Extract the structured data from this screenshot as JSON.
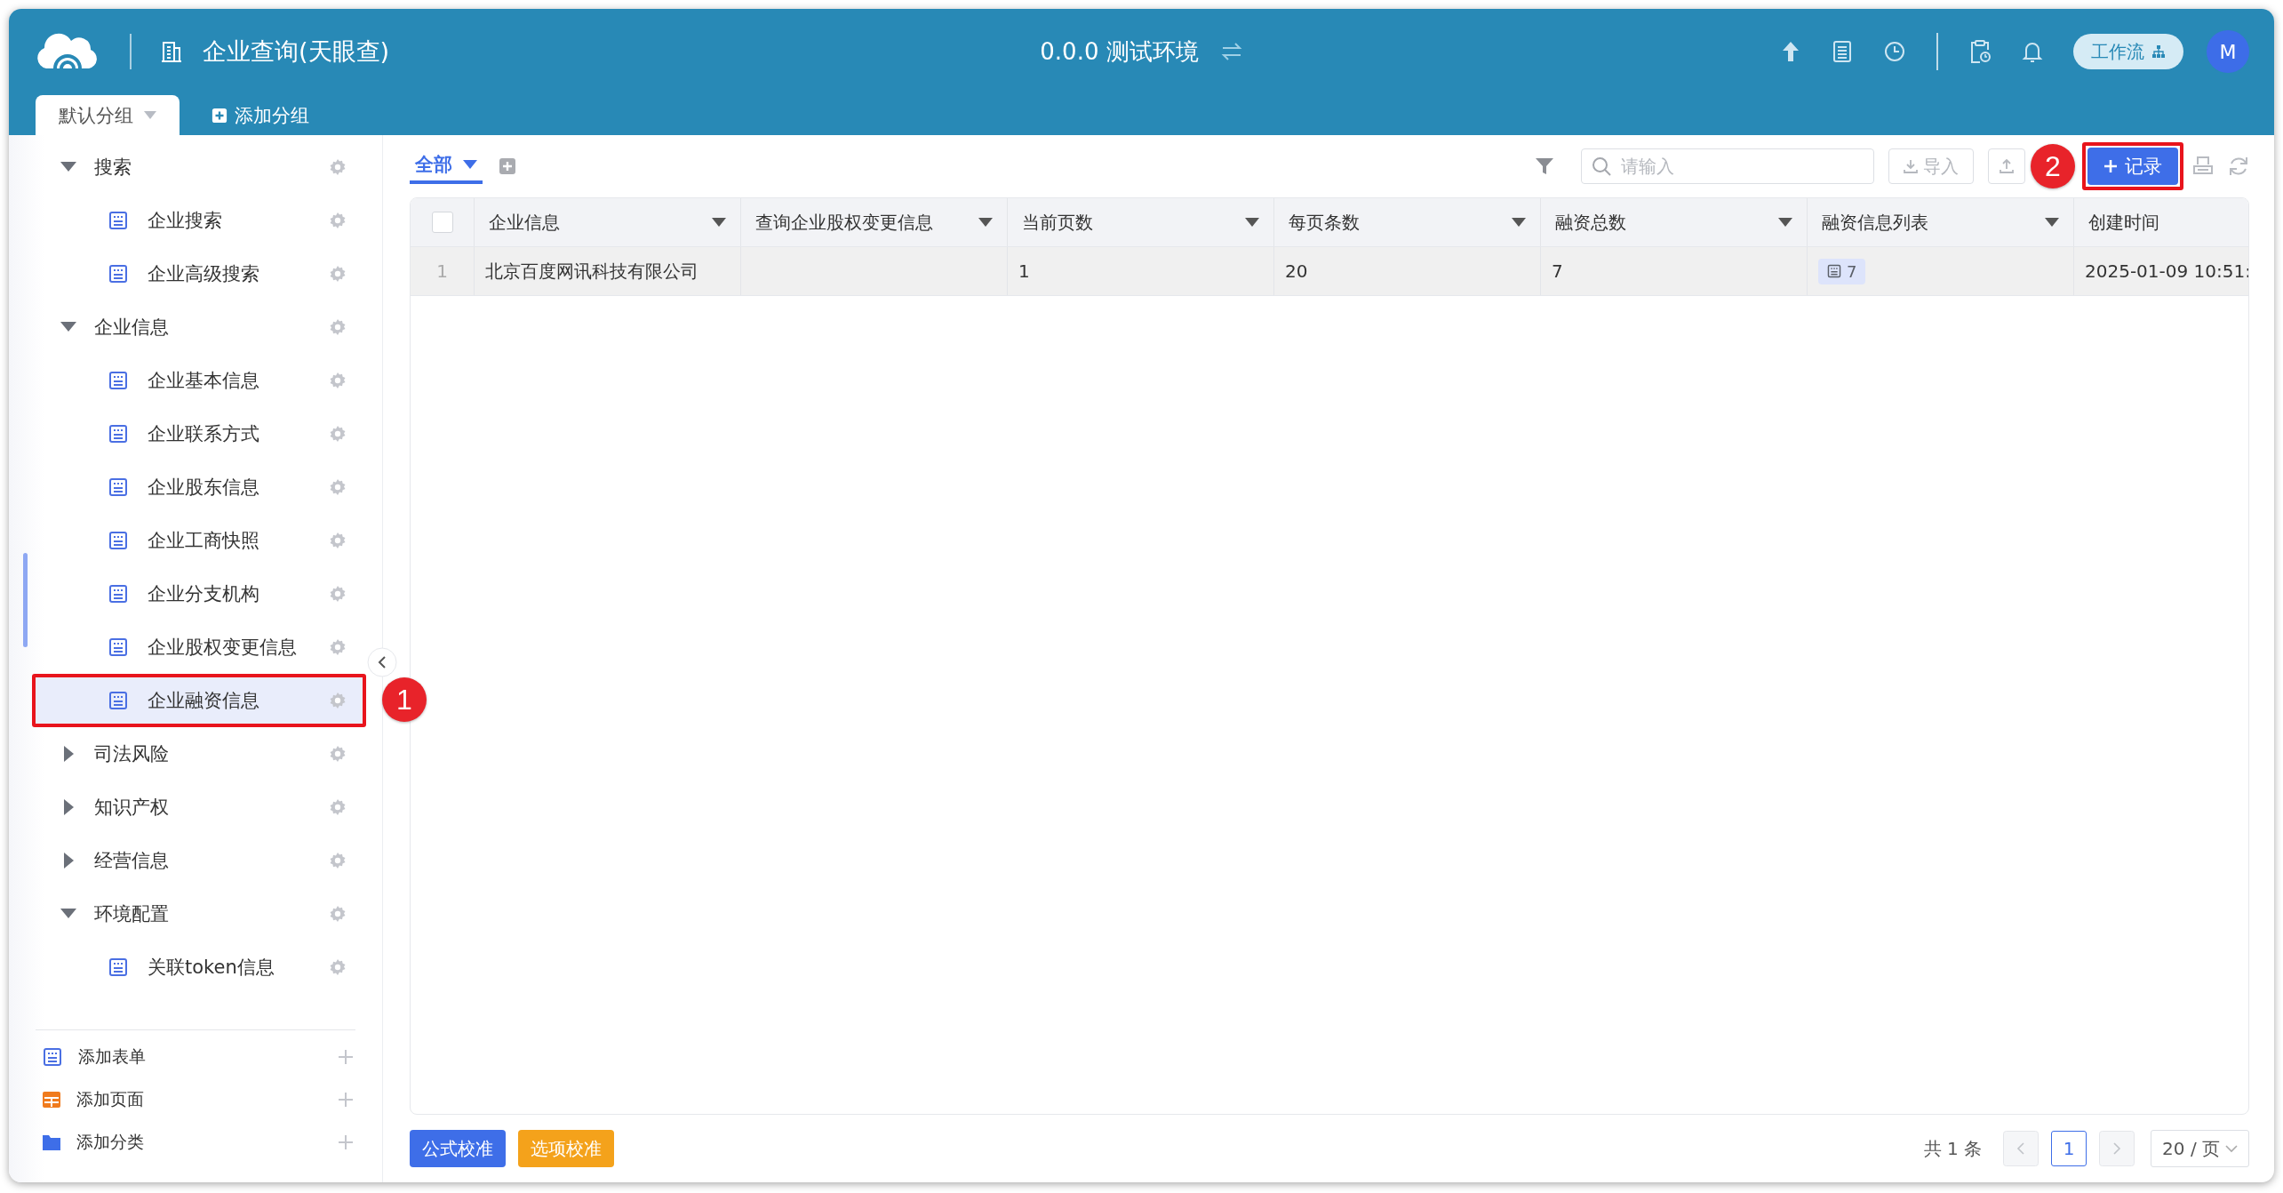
{
  "header": {
    "title": "企业查询(天眼查)",
    "environment": "0.0.0 测试环境",
    "workflow_button": "工作流",
    "avatar": "M"
  },
  "group_tabs": [
    {
      "label": "默认分组",
      "selected": true
    }
  ],
  "add_group_button": "添加分组",
  "sidebar": {
    "tree": [
      {
        "kind": "folder",
        "label": "搜索",
        "expanded": true,
        "selected": false,
        "children": [
          {
            "kind": "form",
            "label": "企业搜索",
            "selected": false
          },
          {
            "kind": "form",
            "label": "企业高级搜索",
            "selected": false
          }
        ]
      },
      {
        "kind": "folder",
        "label": "企业信息",
        "expanded": true,
        "selected": false,
        "children": [
          {
            "kind": "form",
            "label": "企业基本信息",
            "selected": false
          },
          {
            "kind": "form",
            "label": "企业联系方式",
            "selected": false
          },
          {
            "kind": "form",
            "label": "企业股东信息",
            "selected": false
          },
          {
            "kind": "form",
            "label": "企业工商快照",
            "selected": false
          },
          {
            "kind": "form",
            "label": "企业分支机构",
            "selected": false
          },
          {
            "kind": "form",
            "label": "企业股权变更信息",
            "selected": false
          },
          {
            "kind": "form",
            "label": "企业融资信息",
            "selected": true,
            "annotation": "1"
          }
        ]
      },
      {
        "kind": "folder",
        "label": "司法风险",
        "expanded": false,
        "selected": false
      },
      {
        "kind": "folder",
        "label": "知识产权",
        "expanded": false,
        "selected": false
      },
      {
        "kind": "folder",
        "label": "经营信息",
        "expanded": false,
        "selected": false
      },
      {
        "kind": "folder",
        "label": "环境配置",
        "expanded": true,
        "selected": false,
        "children": [
          {
            "kind": "form",
            "label": "关联token信息",
            "selected": false
          }
        ]
      }
    ],
    "actions": [
      {
        "kind": "form",
        "label": "添加表单"
      },
      {
        "kind": "page",
        "label": "添加页面"
      },
      {
        "kind": "folder",
        "label": "添加分类"
      }
    ]
  },
  "view_tabs": [
    {
      "label": "全部",
      "selected": true
    }
  ],
  "toolbar": {
    "search_placeholder": "请输入",
    "import_button": "导入",
    "add_record_button": "记录",
    "add_record_annotation": "2"
  },
  "table": {
    "columns": [
      {
        "kind": "select",
        "checked": false
      },
      {
        "label": "企业信息",
        "menu": true
      },
      {
        "label": "查询企业股权变更信息",
        "menu": true
      },
      {
        "label": "当前页数",
        "menu": true
      },
      {
        "label": "每页条数",
        "menu": true
      },
      {
        "label": "融资总数",
        "menu": true
      },
      {
        "label": "融资信息列表",
        "menu": true
      },
      {
        "label": "创建时间"
      }
    ],
    "rows": [
      {
        "cells": [
          {
            "kind": "index",
            "text": "1"
          },
          {
            "kind": "text",
            "text": "北京百度网讯科技有限公司"
          },
          {
            "kind": "empty"
          },
          {
            "kind": "text",
            "text": "1"
          },
          {
            "kind": "text",
            "text": "20"
          },
          {
            "kind": "text",
            "text": "7"
          },
          {
            "kind": "subtable",
            "text": "7"
          },
          {
            "kind": "text",
            "text": "2025-01-09 10:51:"
          }
        ]
      }
    ]
  },
  "footer": {
    "buttons": [
      {
        "kind": "primary",
        "label": "公式校准"
      },
      {
        "kind": "warning",
        "label": "选项校准"
      }
    ],
    "total": "共 1 条",
    "pages": [
      {
        "label": "1",
        "selected": true
      }
    ],
    "page_size": "20 / 页"
  }
}
